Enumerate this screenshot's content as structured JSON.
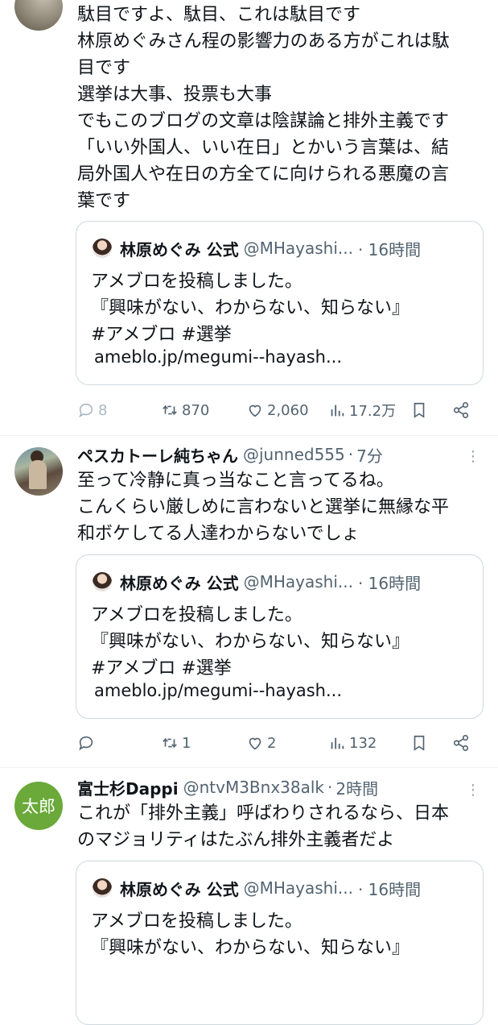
{
  "quoted": {
    "name": "林原めぐみ 公式",
    "handle": "@MHayashi...",
    "time": "16時間",
    "text_lines": [
      "アメブロを投稿しました。",
      "『興味がない、わからない、知らない』",
      "#アメブロ #選挙"
    ],
    "link": "ameblo.jp/megumi--hayash..."
  },
  "posts": [
    {
      "body_lines": [
        "駄目ですよ、駄目、これは駄目です",
        "林原めぐみさん程の影響力のある方がこれは駄",
        "目です",
        "選挙は大事、投票も大事",
        "でもこのブログの文章は陰謀論と排外主義です",
        "「いい外国人、いい在日」とかいう言葉は、結",
        "局外国人や在日の方全てに向けられる悪魔の言",
        "葉です"
      ],
      "stats": {
        "replies": "8",
        "reposts": "870",
        "likes": "2,060",
        "views": "17.2万"
      }
    },
    {
      "name": "ペスカトーレ純ちゃん",
      "handle": "@junned555",
      "time": "7分",
      "body_lines": [
        "至って冷静に真っ当なこと言ってるね。",
        "こんくらい厳しめに言わないと選挙に無縁な平",
        "和ボケしてる人達わからないでしょ"
      ],
      "stats": {
        "replies": "",
        "reposts": "1",
        "likes": "2",
        "views": "132"
      }
    },
    {
      "name": "富士杉Dappi",
      "handle": "@ntvM3Bnx38alk",
      "time": "2時間",
      "avatar_text": "太郎",
      "body_lines": [
        "これが「排外主義」呼ばわりされるなら、日本",
        "のマジョリティはたぶん排外主義者だよ"
      ]
    }
  ],
  "icons": [
    "reply-icon",
    "repost-icon",
    "like-icon",
    "views-icon",
    "bookmark-icon",
    "share-icon",
    "more-icon"
  ],
  "colors": {
    "text": "#0f1419",
    "secondary": "#536471",
    "border": "#cfd9de",
    "avatar_green": "#6aa93a"
  }
}
